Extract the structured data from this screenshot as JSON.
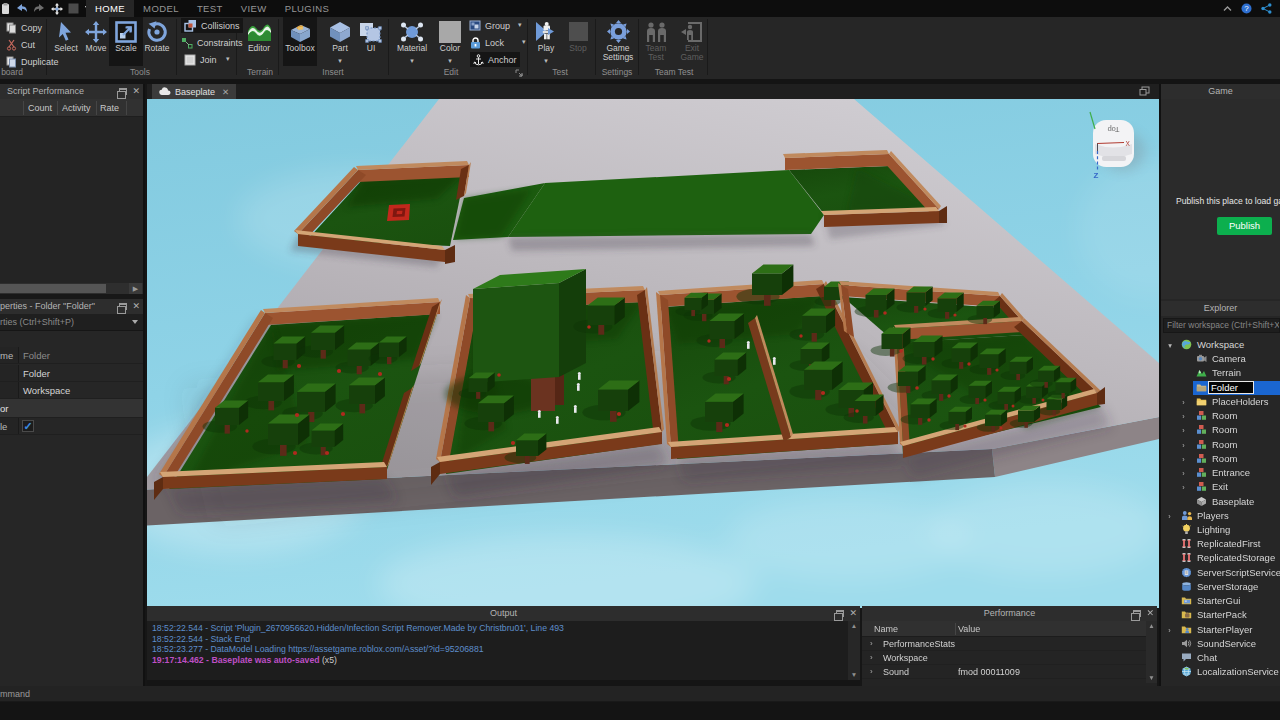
{
  "app": {
    "name": "Roblox Studio"
  },
  "titlebar": {
    "quick_access_icons": [
      "paste-icon",
      "undo-icon",
      "redo-icon",
      "move-tool-icon",
      "inactive-icon",
      "dropdown-icon"
    ],
    "tabs": [
      {
        "label": "HOME",
        "active": true
      },
      {
        "label": "MODEL",
        "active": false
      },
      {
        "label": "TEST",
        "active": false
      },
      {
        "label": "VIEW",
        "active": false
      },
      {
        "label": "PLUGINS",
        "active": false
      }
    ],
    "right_icons": [
      "collapse-ribbon-icon",
      "help-icon",
      "share-icon"
    ]
  },
  "ribbon": {
    "groups": [
      {
        "label": "board",
        "items": [
          {
            "label": "Copy",
            "icon": "copy",
            "kind": "row"
          },
          {
            "label": "Cut",
            "icon": "cut",
            "kind": "row"
          },
          {
            "label": "Duplicate",
            "icon": "duplicate",
            "kind": "row"
          }
        ]
      },
      {
        "label": "Tools",
        "items": [
          {
            "label": "Select",
            "icon": "select",
            "kind": "big"
          },
          {
            "label": "Move",
            "icon": "move",
            "kind": "big"
          },
          {
            "label": "Scale",
            "icon": "scale",
            "kind": "big",
            "state": "selected"
          },
          {
            "label": "Rotate",
            "icon": "rotate",
            "kind": "big"
          }
        ]
      },
      {
        "label": "",
        "items": [
          {
            "label": "Collisions",
            "icon": "collisions",
            "kind": "row",
            "state": "selected"
          },
          {
            "label": "Constraints",
            "icon": "constraints",
            "kind": "row"
          },
          {
            "label": "Join",
            "icon": "join",
            "kind": "row",
            "dropdown": true
          }
        ]
      },
      {
        "label": "Terrain",
        "items": [
          {
            "label": "Editor",
            "icon": "editor",
            "kind": "big"
          }
        ]
      },
      {
        "label": "Insert",
        "items": [
          {
            "label": "Toolbox",
            "icon": "toolbox",
            "kind": "big",
            "state": "selected"
          },
          {
            "label": "Part",
            "icon": "part",
            "kind": "big",
            "dropdown": true
          },
          {
            "label": "UI",
            "icon": "ui",
            "kind": "big"
          }
        ]
      },
      {
        "label": "Edit",
        "launcher": true,
        "items": [
          {
            "label": "Material",
            "icon": "material",
            "kind": "big",
            "dropdown": true
          },
          {
            "label": "Color",
            "icon": "color",
            "kind": "big",
            "dropdown": true
          },
          {
            "label": "Group",
            "icon": "group",
            "kind": "row",
            "dropdown": true
          },
          {
            "label": "Lock",
            "icon": "lock",
            "kind": "row",
            "dropdown": true
          },
          {
            "label": "Anchor",
            "icon": "anchor",
            "kind": "row",
            "state": "selected"
          }
        ]
      },
      {
        "label": "Test",
        "items": [
          {
            "label": "Play",
            "icon": "play",
            "kind": "big",
            "dropdown": true
          },
          {
            "label": "Stop",
            "icon": "stop",
            "kind": "big",
            "state": "disabled"
          }
        ]
      },
      {
        "label": "Settings",
        "items": [
          {
            "label": "Game\nSettings",
            "icon": "gear",
            "kind": "big"
          }
        ]
      },
      {
        "label": "Team Test",
        "items": [
          {
            "label": "Team\nTest",
            "icon": "teamtest",
            "kind": "big",
            "state": "disabled"
          },
          {
            "label": "Exit\nGame",
            "icon": "exitgame",
            "kind": "big",
            "state": "disabled"
          }
        ]
      }
    ]
  },
  "script_performance": {
    "title": "Script Performance",
    "columns": [
      "Count",
      "Activity",
      "Rate"
    ]
  },
  "properties": {
    "title": "perties - Folder \"Folder\"",
    "filter": "rties (Ctrl+Shift+P)",
    "rows": [
      {
        "label": "me",
        "value": "Folder",
        "dim": true
      },
      {
        "label": "",
        "value": "Folder",
        "dim": false
      },
      {
        "label": "",
        "value": "Workspace",
        "dim": false
      }
    ],
    "section": "or",
    "checkbox_row": {
      "label": "le",
      "checked": true
    }
  },
  "viewport": {
    "tab_label": "Baseplate",
    "viewcube": {
      "top_label": "Top",
      "x_label": "X",
      "z_label": "Z"
    }
  },
  "game_panel": {
    "title": "Game",
    "publish_hint": "Publish this place to load ga",
    "publish_button": "Publish",
    "publish_color": "#0caf4e"
  },
  "explorer": {
    "title": "Explorer",
    "filter_placeholder": "Filter workspace (Ctrl+Shift+X)",
    "items": [
      {
        "label": "Workspace",
        "icon": "workspace",
        "depth": 0,
        "expander": "open"
      },
      {
        "label": "Camera",
        "icon": "camera",
        "depth": 1,
        "expander": ""
      },
      {
        "label": "Terrain",
        "icon": "terrain",
        "depth": 1,
        "expander": ""
      },
      {
        "label": "Folder",
        "icon": "folder",
        "depth": 1,
        "expander": "",
        "selected": true,
        "editing": true
      },
      {
        "label": "PlaceHolders",
        "icon": "folderyellow",
        "depth": 1,
        "expander": "closed"
      },
      {
        "label": "Room",
        "icon": "model",
        "depth": 1,
        "expander": "closed"
      },
      {
        "label": "Room",
        "icon": "model",
        "depth": 1,
        "expander": "closed"
      },
      {
        "label": "Room",
        "icon": "model",
        "depth": 1,
        "expander": "closed"
      },
      {
        "label": "Room",
        "icon": "model",
        "depth": 1,
        "expander": "closed"
      },
      {
        "label": "Entrance",
        "icon": "model",
        "depth": 1,
        "expander": "closed"
      },
      {
        "label": "Exit",
        "icon": "model",
        "depth": 1,
        "expander": "closed"
      },
      {
        "label": "Baseplate",
        "icon": "partgray",
        "depth": 1,
        "expander": ""
      },
      {
        "label": "Players",
        "icon": "players",
        "depth": 0,
        "expander": "closed"
      },
      {
        "label": "Lighting",
        "icon": "lighting",
        "depth": 0,
        "expander": ""
      },
      {
        "label": "ReplicatedFirst",
        "icon": "replicated",
        "depth": 0,
        "expander": ""
      },
      {
        "label": "ReplicatedStorage",
        "icon": "replicated",
        "depth": 0,
        "expander": ""
      },
      {
        "label": "ServerScriptService",
        "icon": "serverscript",
        "depth": 0,
        "expander": ""
      },
      {
        "label": "ServerStorage",
        "icon": "serverstorage",
        "depth": 0,
        "expander": ""
      },
      {
        "label": "StarterGui",
        "icon": "startergui",
        "depth": 0,
        "expander": ""
      },
      {
        "label": "StarterPack",
        "icon": "starterpack",
        "depth": 0,
        "expander": ""
      },
      {
        "label": "StarterPlayer",
        "icon": "starterplayer",
        "depth": 0,
        "expander": "closed"
      },
      {
        "label": "SoundService",
        "icon": "sound",
        "depth": 0,
        "expander": ""
      },
      {
        "label": "Chat",
        "icon": "chat",
        "depth": 0,
        "expander": ""
      },
      {
        "label": "LocalizationService",
        "icon": "localization",
        "depth": 0,
        "expander": ""
      }
    ]
  },
  "output": {
    "title": "Output",
    "lines": [
      {
        "text": "18:52:22.544 - Script 'Plugin_2670956620.Hidden/Infection Script Remover.Made by Christbru01', Line 493",
        "color": "blue",
        "suffix": ""
      },
      {
        "text": "18:52:22.544 - Stack End",
        "color": "blue",
        "suffix": ""
      },
      {
        "text": "18:52:23.277 - DataModel Loading https://assetgame.roblox.com/Asset/?id=95206881",
        "color": "blue",
        "suffix": ""
      },
      {
        "text": "19:17:14.462 - Baseplate was auto-saved",
        "color": "magenta",
        "suffix": " (x5)"
      }
    ]
  },
  "performance": {
    "title": "Performance",
    "columns": [
      "Name",
      "Value"
    ],
    "rows": [
      {
        "name": "PerformanceStats",
        "value": "",
        "expander": true
      },
      {
        "name": "Workspace",
        "value": "",
        "expander": true
      },
      {
        "name": "Sound",
        "value": "fmod 00011009",
        "expander": true
      }
    ]
  },
  "command_bar": {
    "visible_text": "mmand"
  }
}
